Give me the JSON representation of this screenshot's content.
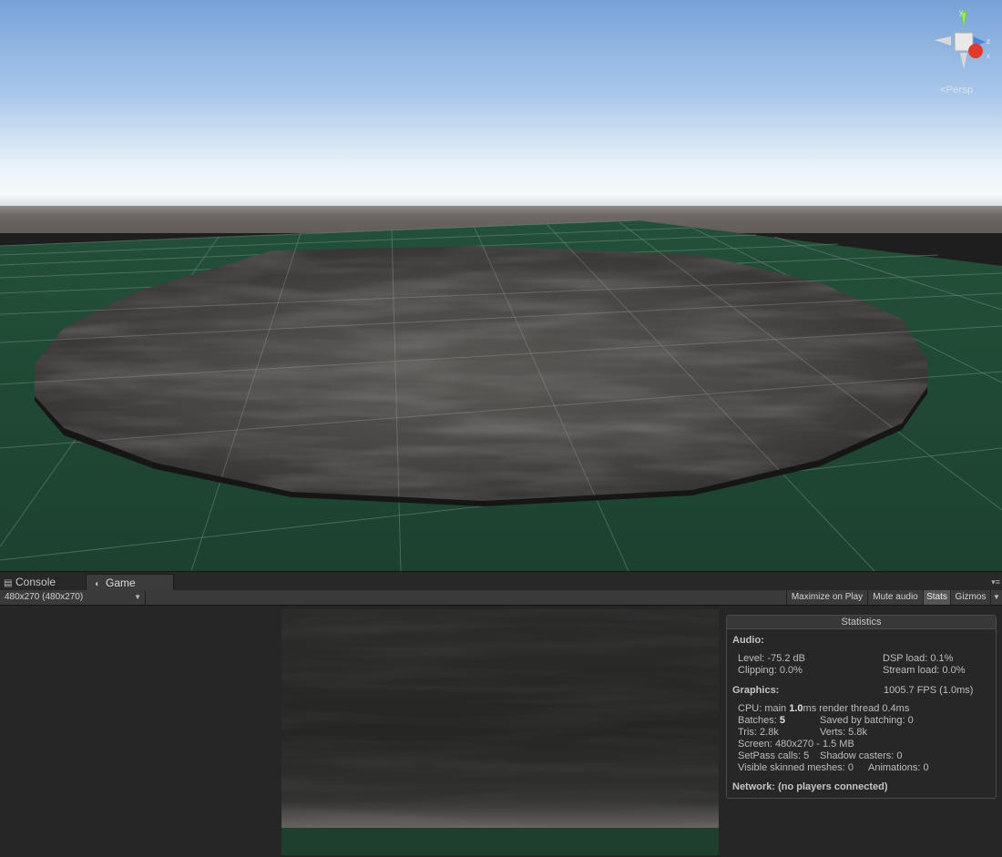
{
  "scene": {
    "persp_label": "Persp",
    "gizmo_axes": {
      "y": "y",
      "z": "z",
      "x": "x"
    },
    "colors": {
      "sky_top": "#7aa4d8",
      "sky_horizon": "#f4f8fa",
      "ground_far": "#6e6864",
      "grid_floor": "#1e4433",
      "disc": "#3a3a38"
    }
  },
  "tabs": [
    {
      "label": "Console",
      "icon": "console-icon"
    },
    {
      "label": "Game",
      "icon": "game-controller-icon"
    }
  ],
  "toolbar": {
    "resolution": "480x270 (480x270)",
    "maximize_on_play": "Maximize on Play",
    "mute_audio": "Mute audio",
    "stats": "Stats",
    "gizmos": "Gizmos"
  },
  "stats": {
    "title": "Statistics",
    "audio": {
      "heading": "Audio:",
      "level": "Level: -75.2 dB",
      "clipping": "Clipping: 0.0%",
      "dsp_load": "DSP load: 0.1%",
      "stream_load": "Stream load: 0.0%"
    },
    "graphics": {
      "heading": "Graphics:",
      "fps": "1005.7 FPS (1.0ms)",
      "cpu_prefix": "CPU: main ",
      "cpu_main": "1.0",
      "cpu_suffix": "ms  render thread 0.4ms",
      "batches_prefix": "Batches: ",
      "batches_value": "5",
      "saved_by_batching": "Saved by batching: 0",
      "tris": "Tris: 2.8k",
      "verts": "Verts: 5.8k",
      "screen": "Screen: 480x270 - 1.5 MB",
      "setpass": "SetPass calls: 5",
      "shadow_casters": "Shadow casters: 0",
      "skinned_meshes": "Visible skinned meshes: 0",
      "animations": "Animations: 0"
    },
    "network": "Network: (no players connected)"
  }
}
